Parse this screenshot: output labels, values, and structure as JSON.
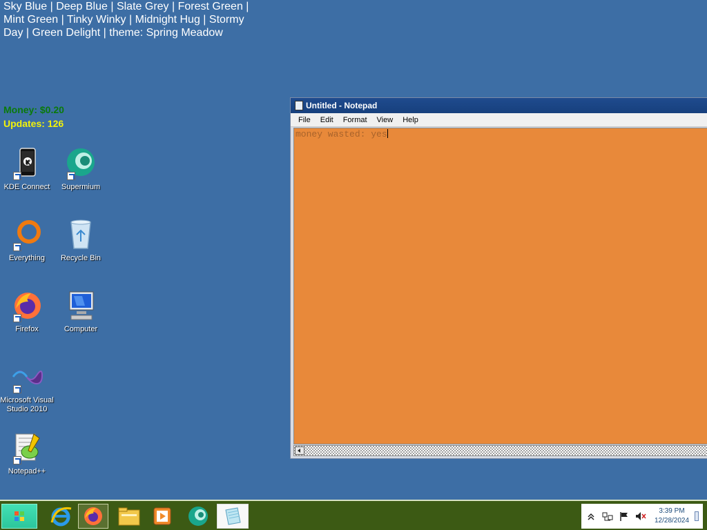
{
  "overlay": {
    "theme_line": "Sky Blue | Deep Blue | Slate Grey | Forest Green | Mint Green | Tinky Winky | Midnight Hug | Stormy Day | Green Delight | theme: Spring Meadow",
    "money": "Money: $0.20",
    "updates": "Updates: 126"
  },
  "desktop_icons": [
    {
      "label": "KDE Connect",
      "icon": "kde-connect-icon"
    },
    {
      "label": "Supermium",
      "icon": "supermium-icon"
    },
    {
      "label": "Everything",
      "icon": "everything-icon"
    },
    {
      "label": "Recycle Bin",
      "icon": "recycle-bin-icon"
    },
    {
      "label": "Firefox",
      "icon": "firefox-icon"
    },
    {
      "label": "Computer",
      "icon": "computer-icon"
    },
    {
      "label": "Microsoft Visual Studio 2010",
      "icon": "visual-studio-icon"
    },
    {
      "label": "Notepad++",
      "icon": "notepad-plus-plus-icon"
    }
  ],
  "notepad": {
    "title": "Untitled - Notepad",
    "menu": [
      "File",
      "Edit",
      "Format",
      "View",
      "Help"
    ],
    "content": "money wasted: yes",
    "background_color": "#e8893a"
  },
  "taskbar": {
    "pinned": [
      {
        "icon": "internet-explorer-icon"
      },
      {
        "icon": "firefox-icon"
      },
      {
        "icon": "file-explorer-icon"
      },
      {
        "icon": "media-player-icon"
      },
      {
        "icon": "supermium-icon"
      },
      {
        "icon": "notepad-icon"
      }
    ],
    "tray_icons": [
      "show-hidden-icons-icon",
      "network-icon",
      "action-center-flag-icon",
      "volume-muted-icon"
    ],
    "time": "3:39 PM",
    "date": "12/28/2024"
  },
  "colors": {
    "desktop": "#3d6ea5",
    "money": "#0a7a0a",
    "updates": "#f2f20a",
    "taskbar": "#3c5a14",
    "start_button": "#2cc79c"
  }
}
